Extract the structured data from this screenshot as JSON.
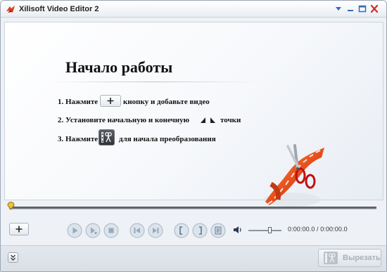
{
  "window": {
    "title": "Xilisoft Video Editor 2"
  },
  "preview": {
    "heading": "Начало работы",
    "steps": {
      "step1_prefix": "1. Нажмите",
      "step1_suffix": "кнопку и добавьте видео",
      "step2_prefix": "2. Установите начальную и конечную",
      "step2_suffix": "точки",
      "step3_prefix": "3. Нажмите",
      "step3_suffix": "для начала преобразования"
    }
  },
  "timeline": {
    "position": 0.0
  },
  "controls": {
    "add_label": "+",
    "volume_level": 0.65,
    "time_display": "0:00:00.0 / 0:00:00.0"
  },
  "footer": {
    "cut_label": "Вырезать"
  },
  "icons": {
    "app": "app-logo-icon",
    "menu": "menu-triangle-icon",
    "minimize": "minimize-icon",
    "maximize": "maximize-icon",
    "close": "close-icon",
    "play": "play-icon",
    "play_segment": "play-segment-icon",
    "stop": "stop-icon",
    "prev_frame": "previous-frame-icon",
    "next_frame": "next-frame-icon",
    "set_start": "set-start-point-icon",
    "set_end": "set-end-point-icon",
    "snapshot": "snapshot-icon",
    "volume": "speaker-icon",
    "expand": "expand-chevron-icon",
    "cut": "scissors-film-icon"
  },
  "colors": {
    "accent_blue": "#2f6fb5",
    "close_red": "#c9302c",
    "knob_yellow": "#f2c230",
    "logo_orange": "#e8501c"
  }
}
